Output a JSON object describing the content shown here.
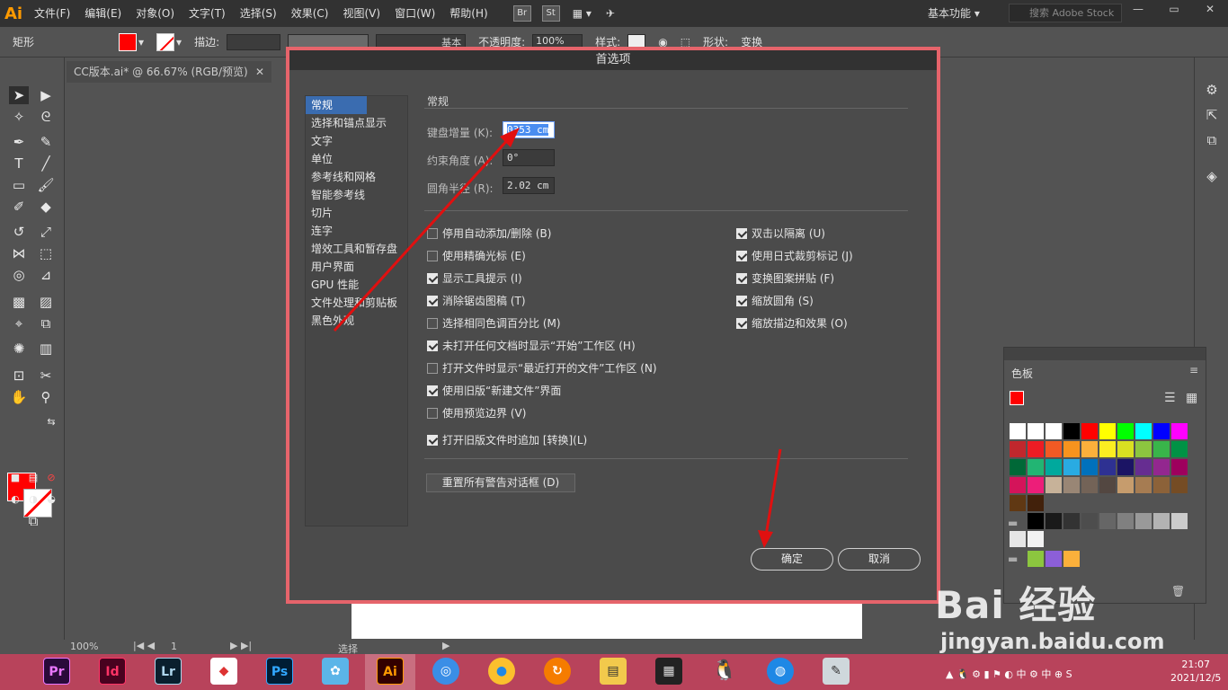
{
  "menubar": {
    "logo": "Ai",
    "items": [
      "文件(F)",
      "编辑(E)",
      "对象(O)",
      "文字(T)",
      "选择(S)",
      "效果(C)",
      "视图(V)",
      "窗口(W)",
      "帮助(H)"
    ],
    "br": "Br",
    "st": "St",
    "workspace": "基本功能",
    "stock_search": "搜索 Adobe Stock"
  },
  "ctrlbar": {
    "object_type": "矩形",
    "stroke_label": "描边:",
    "opacity_label": "不透明度:",
    "opacity_value": "100%",
    "style_label": "样式:",
    "basic": "基本",
    "shape_label": "形状:",
    "transform_label": "变换"
  },
  "doc": {
    "tab_title": "CC版本.ai* @ 66.67% (RGB/预览)",
    "zoom": "100%",
    "page": "1",
    "status": "选择"
  },
  "dialog": {
    "title": "首选项",
    "categories": [
      "常规",
      "选择和锚点显示",
      "文字",
      "单位",
      "参考线和网格",
      "智能参考线",
      "切片",
      "连字",
      "增效工具和暂存盘",
      "用户界面",
      "GPU 性能",
      "文件处理和剪贴板",
      "黑色外观"
    ],
    "section": "常规",
    "keyboard_increment_label": "键盘增量 (K):",
    "keyboard_increment_value": "0353 cm",
    "constrain_angle_label": "约束角度 (A):",
    "constrain_angle_value": "0°",
    "corner_radius_label": "圆角半径 (R):",
    "corner_radius_value": "2.02 cm",
    "left_options": [
      {
        "label": "停用自动添加/删除 (B)",
        "checked": false
      },
      {
        "label": "使用精确光标 (E)",
        "checked": false
      },
      {
        "label": "显示工具提示 (I)",
        "checked": true
      },
      {
        "label": "消除锯齿图稿 (T)",
        "checked": true
      },
      {
        "label": "选择相同色调百分比 (M)",
        "checked": false
      },
      {
        "label": "未打开任何文档时显示“开始”工作区 (H)",
        "checked": true
      },
      {
        "label": "打开文件时显示“最近打开的文件”工作区 (N)",
        "checked": false
      },
      {
        "label": "使用旧版“新建文件”界面",
        "checked": true
      },
      {
        "label": "使用预览边界 (V)",
        "checked": false
      },
      {
        "label": "打开旧版文件时追加 [转换](L)",
        "checked": true
      }
    ],
    "right_options": [
      {
        "label": "双击以隔离 (U)",
        "checked": true
      },
      {
        "label": "使用日式裁剪标记 (J)",
        "checked": true
      },
      {
        "label": "变换图案拼贴 (F)",
        "checked": true
      },
      {
        "label": "缩放圆角 (S)",
        "checked": true
      },
      {
        "label": "缩放描边和效果 (O)",
        "checked": true
      }
    ],
    "reset_button": "重置所有警告对话框 (D)",
    "ok_button": "确定",
    "cancel_button": "取消"
  },
  "swatches": {
    "title": "色板",
    "colors": [
      "#ffffff",
      "#ffffff",
      "#ffffff",
      "#000000",
      "#ff0000",
      "#ffff00",
      "#00ff00",
      "#00ffff",
      "#0000ff",
      "#ff00ff",
      "#c1272d",
      "#ed1c24",
      "#f15a24",
      "#f7931e",
      "#fbb03b",
      "#fcee21",
      "#d9e021",
      "#8cc63f",
      "#39b54a",
      "#009245",
      "#006837",
      "#22b573",
      "#00a99d",
      "#29abe2",
      "#0071bc",
      "#2e3192",
      "#1b1464",
      "#662d91",
      "#93278f",
      "#9e005d",
      "#d4145a",
      "#ed1e79",
      "#c7b299",
      "#998675",
      "#736357",
      "#534741",
      "#c69c6d",
      "#a67c52",
      "#8c6239",
      "#754c24",
      "#603813",
      "#42210b"
    ],
    "grays": [
      "#000000",
      "#1a1a1a",
      "#333333",
      "#4d4d4d",
      "#666666",
      "#808080",
      "#999999",
      "#b3b3b3",
      "#cccccc",
      "#e6e6e6",
      "#f2f2f2"
    ],
    "group3": [
      "#8cc63f",
      "#8c5fd8",
      "#fbb03b"
    ]
  },
  "taskbar": {
    "time": "21:07",
    "date": "2021/12/5",
    "icons": [
      "Pr",
      "Id",
      "Lr",
      "Ps",
      "Ai"
    ]
  },
  "watermark": {
    "brand": "Bai 经验",
    "url": "jingyan.baidu.com"
  }
}
